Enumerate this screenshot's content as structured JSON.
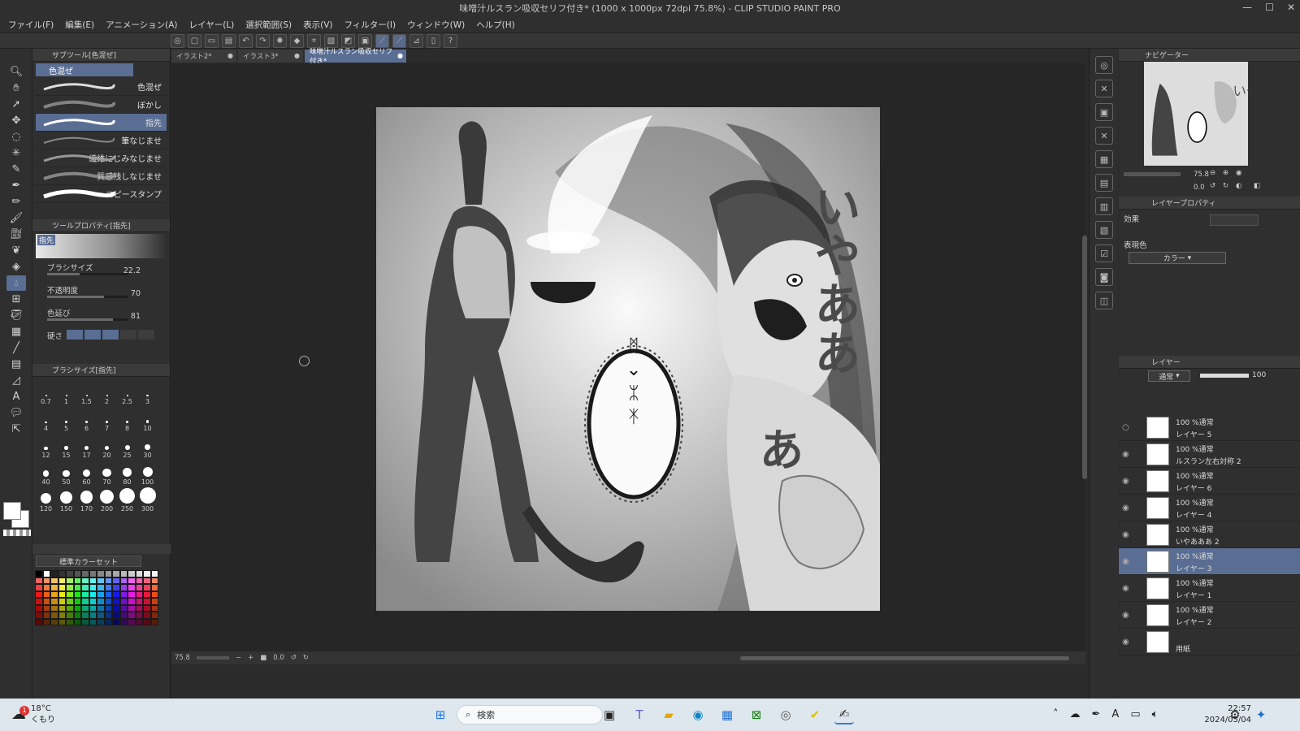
{
  "window": {
    "title": "味噌汁ルスラン吸収セリフ付き* (1000 x 1000px 72dpi 75.8%) - CLIP STUDIO PAINT PRO"
  },
  "menu": [
    "ファイル(F)",
    "編集(E)",
    "アニメーション(A)",
    "レイヤー(L)",
    "選択範囲(S)",
    "表示(V)",
    "フィルター(I)",
    "ウィンドウ(W)",
    "ヘルプ(H)"
  ],
  "subtool_panel": {
    "title": "サブツール[色混ぜ]",
    "group": "色混ぜ",
    "items": [
      {
        "label": "色混ぜ"
      },
      {
        "label": "ぼかし"
      },
      {
        "label": "指先"
      },
      {
        "label": "筆なじませ"
      },
      {
        "label": "繊維にじみなじませ"
      },
      {
        "label": "質感残しなじませ"
      },
      {
        "label": "コピースタンプ"
      }
    ]
  },
  "tool_property": {
    "title": "ツールプロパティ[指先]",
    "preview_label": "指先",
    "brush_size": {
      "label": "ブラシサイズ",
      "value": "22.2",
      "fill": 0.4
    },
    "opacity": {
      "label": "不透明度",
      "value": "70",
      "fill": 0.7
    },
    "color_extend": {
      "label": "色延び",
      "value": "81",
      "fill": 0.81
    },
    "hardness_label": "硬さ"
  },
  "brush_size_panel": {
    "title": "ブラシサイズ[指先]",
    "sizes": [
      "0.7",
      "1",
      "1.5",
      "2",
      "2.5",
      "3",
      "4",
      "5",
      "6",
      "7",
      "8",
      "10",
      "12",
      "15",
      "17",
      "20",
      "25",
      "30",
      "40",
      "50",
      "60",
      "70",
      "80",
      "100",
      "120",
      "150",
      "170",
      "200",
      "250",
      "300"
    ]
  },
  "color_set": {
    "name": "標準カラーセット"
  },
  "doc_tabs": [
    {
      "label": "イラスト2*"
    },
    {
      "label": "イラスト3*"
    },
    {
      "label": "味噌汁ルスラン吸収セリフ付き*"
    }
  ],
  "canvas": {
    "text_vertical": [
      "い",
      "や",
      "あ",
      "あ",
      "あ"
    ],
    "text_extra": "あ",
    "speech_glyphs": [
      "ᛗ",
      "⌄",
      "ᛯ",
      "ᛡ"
    ]
  },
  "status": {
    "zoom": "75.8",
    "angle": "0.0"
  },
  "navigator": {
    "title": "ナビゲーター",
    "zoom": "75.8",
    "angle": "0.0"
  },
  "layer_property": {
    "title": "レイヤープロパティ",
    "effect_label": "効果",
    "color_label": "表現色",
    "color_value": "カラー"
  },
  "layer_panel": {
    "title": "レイヤー",
    "blend": "通常",
    "opacity": "100",
    "layers": [
      {
        "mode": "100 %通常",
        "name": "レイヤー 5",
        "visible": false
      },
      {
        "mode": "100 %通常",
        "name": "ルスラン左右対称 2",
        "visible": true
      },
      {
        "mode": "100 %通常",
        "name": "レイヤー 6",
        "visible": true
      },
      {
        "mode": "100 %通常",
        "name": "レイヤー 4",
        "visible": true
      },
      {
        "mode": "100 %通常",
        "name": "いやあああ 2",
        "visible": true
      },
      {
        "mode": "100 %通常",
        "name": "レイヤー 3",
        "visible": true,
        "selected": true
      },
      {
        "mode": "100 %通常",
        "name": "レイヤー 1",
        "visible": true
      },
      {
        "mode": "100 %通常",
        "name": "レイヤー 2",
        "visible": true
      },
      {
        "mode": "",
        "name": "用紙",
        "visible": true
      }
    ]
  },
  "taskbar": {
    "weather_temp": "18°C",
    "weather_text": "くもり",
    "weather_badge": "1",
    "search_placeholder": "検索",
    "time": "22:57",
    "date": "2024/05/04"
  }
}
